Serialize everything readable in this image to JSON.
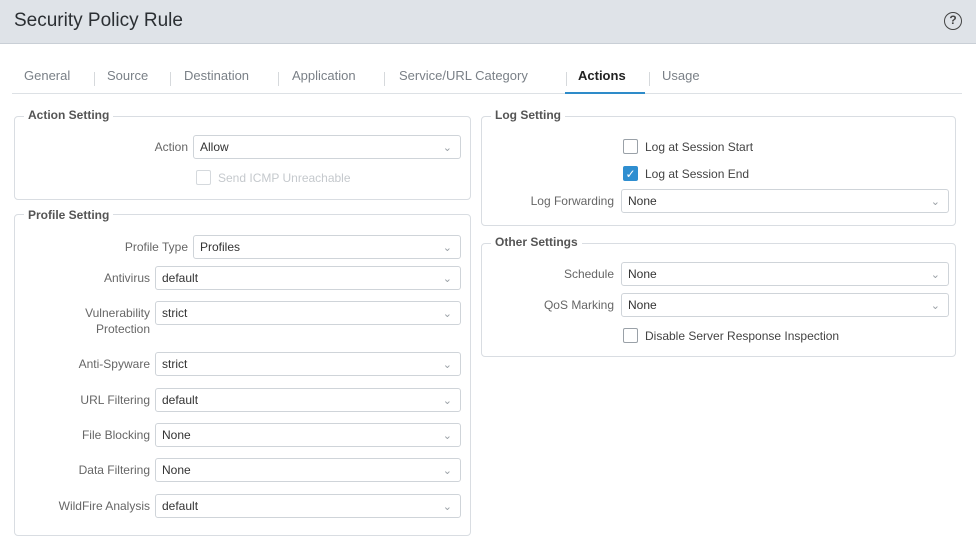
{
  "window": {
    "title": "Security Policy Rule",
    "help": "?"
  },
  "tabs": [
    {
      "label": "General"
    },
    {
      "label": "Source"
    },
    {
      "label": "Destination"
    },
    {
      "label": "Application"
    },
    {
      "label": "Service/URL Category"
    },
    {
      "label": "Actions"
    },
    {
      "label": "Usage"
    }
  ],
  "active_tab": "Actions",
  "action_setting": {
    "legend": "Action Setting",
    "action": {
      "label": "Action",
      "value": "Allow"
    },
    "icmp": {
      "label": "Send ICMP Unreachable",
      "checked": false,
      "disabled": true
    }
  },
  "profile_setting": {
    "legend": "Profile Setting",
    "fields": [
      {
        "label": "Profile Type",
        "value": "Profiles"
      },
      {
        "label": "Antivirus",
        "value": "default"
      },
      {
        "label": "Vulnerability Protection",
        "value": "strict"
      },
      {
        "label": "Anti-Spyware",
        "value": "strict"
      },
      {
        "label": "URL Filtering",
        "value": "default"
      },
      {
        "label": "File Blocking",
        "value": "None"
      },
      {
        "label": "Data Filtering",
        "value": "None"
      },
      {
        "label": "WildFire Analysis",
        "value": "default"
      }
    ]
  },
  "log_setting": {
    "legend": "Log Setting",
    "log_start": {
      "label": "Log at Session Start",
      "checked": false
    },
    "log_end": {
      "label": "Log at Session End",
      "checked": true
    },
    "log_forwarding": {
      "label": "Log Forwarding",
      "value": "None"
    }
  },
  "other_settings": {
    "legend": "Other Settings",
    "schedule": {
      "label": "Schedule",
      "value": "None"
    },
    "qos": {
      "label": "QoS Marking",
      "value": "None"
    },
    "dsri": {
      "label": "Disable Server Response Inspection",
      "checked": false
    }
  },
  "icons": {
    "chevron": "chevron-down-icon",
    "check": "check-icon",
    "help": "help-icon"
  },
  "colors": {
    "accent": "#2e8bc9",
    "titlebar": "#dfe3e8"
  }
}
